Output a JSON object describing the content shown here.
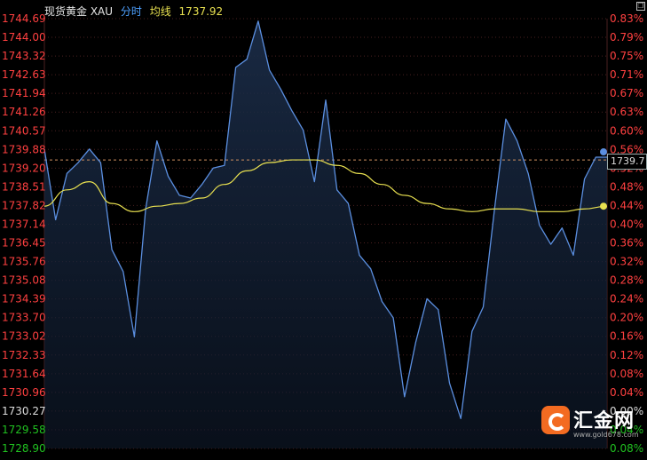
{
  "legend": {
    "name": "现货黄金 XAU",
    "tab": "分时",
    "avg_label": "均线",
    "price": "1737.92"
  },
  "watermark": {
    "name": "汇金网",
    "url": "www.gold678.com"
  },
  "last_price_label": "1739.7",
  "corner_icon": "restore-icon",
  "colors": {
    "price_line": "#5b8fe0",
    "avg_line": "#e8e050",
    "up_text": "#ff4040",
    "down_text": "#20c020",
    "grid": "#4a2020",
    "area_fill": "#0f1a2c"
  },
  "chart_data": {
    "type": "line",
    "ylim": [
      1728.9,
      1744.69
    ],
    "yticks_left": [
      "1744.69",
      "1744.00",
      "1743.32",
      "1742.63",
      "1741.94",
      "1741.26",
      "1740.57",
      "1739.88",
      "1739.20",
      "1738.51",
      "1737.82",
      "1737.14",
      "1736.45",
      "1735.76",
      "1735.08",
      "1734.39",
      "1733.70",
      "1733.02",
      "1732.33",
      "1731.64",
      "1730.96",
      "1730.27",
      "1729.58",
      "1728.90"
    ],
    "yticks_right": [
      "0.83%",
      "0.79%",
      "0.75%",
      "0.71%",
      "0.67%",
      "0.63%",
      "0.60%",
      "0.56%",
      "0.52%",
      "0.48%",
      "0.44%",
      "0.40%",
      "0.36%",
      "0.32%",
      "0.28%",
      "0.24%",
      "0.20%",
      "0.16%",
      "0.12%",
      "0.08%",
      "0.04%",
      "0.00%",
      "0.04%",
      "0.08%"
    ],
    "prev_close": 1730.27,
    "reference_price": 1739.5,
    "price": {
      "name": "现货黄金 XAU",
      "x": [
        0,
        2,
        4,
        6,
        8,
        10,
        12,
        14,
        16,
        18,
        20,
        22,
        24,
        26,
        28,
        30,
        32,
        34,
        36,
        38,
        40,
        42,
        44,
        46,
        48,
        50,
        52,
        54,
        56,
        58,
        60,
        62,
        64,
        66,
        68,
        70,
        72,
        74,
        76,
        78,
        80,
        82,
        84,
        86,
        88,
        90,
        92,
        94,
        96,
        98,
        100
      ],
      "values": [
        1739.9,
        1737.3,
        1739.0,
        1739.4,
        1739.9,
        1739.4,
        1736.2,
        1735.4,
        1733.0,
        1737.7,
        1740.2,
        1738.9,
        1738.2,
        1738.1,
        1738.6,
        1739.2,
        1739.3,
        1742.9,
        1743.2,
        1744.6,
        1742.8,
        1742.1,
        1741.3,
        1740.6,
        1738.7,
        1741.7,
        1738.4,
        1737.9,
        1736.0,
        1735.5,
        1734.3,
        1733.7,
        1730.8,
        1732.8,
        1734.4,
        1734.0,
        1731.3,
        1730.0,
        1733.2,
        1734.1,
        1737.7,
        1741.0,
        1740.2,
        1739.0,
        1737.1,
        1736.4,
        1737.0,
        1736.0,
        1738.8,
        1739.6,
        1739.6
      ]
    },
    "average": {
      "name": "均线",
      "x": [
        0,
        4,
        8,
        12,
        16,
        20,
        24,
        28,
        32,
        36,
        40,
        44,
        48,
        52,
        56,
        60,
        64,
        68,
        72,
        76,
        80,
        84,
        88,
        92,
        96,
        100
      ],
      "values": [
        1737.8,
        1738.4,
        1738.7,
        1737.9,
        1737.6,
        1737.8,
        1737.9,
        1738.1,
        1738.6,
        1739.1,
        1739.4,
        1739.5,
        1739.5,
        1739.3,
        1739.0,
        1738.6,
        1738.2,
        1737.9,
        1737.7,
        1737.6,
        1737.7,
        1737.7,
        1737.6,
        1737.6,
        1737.7,
        1737.8
      ]
    },
    "grid": true,
    "legend_position": "top-left"
  }
}
